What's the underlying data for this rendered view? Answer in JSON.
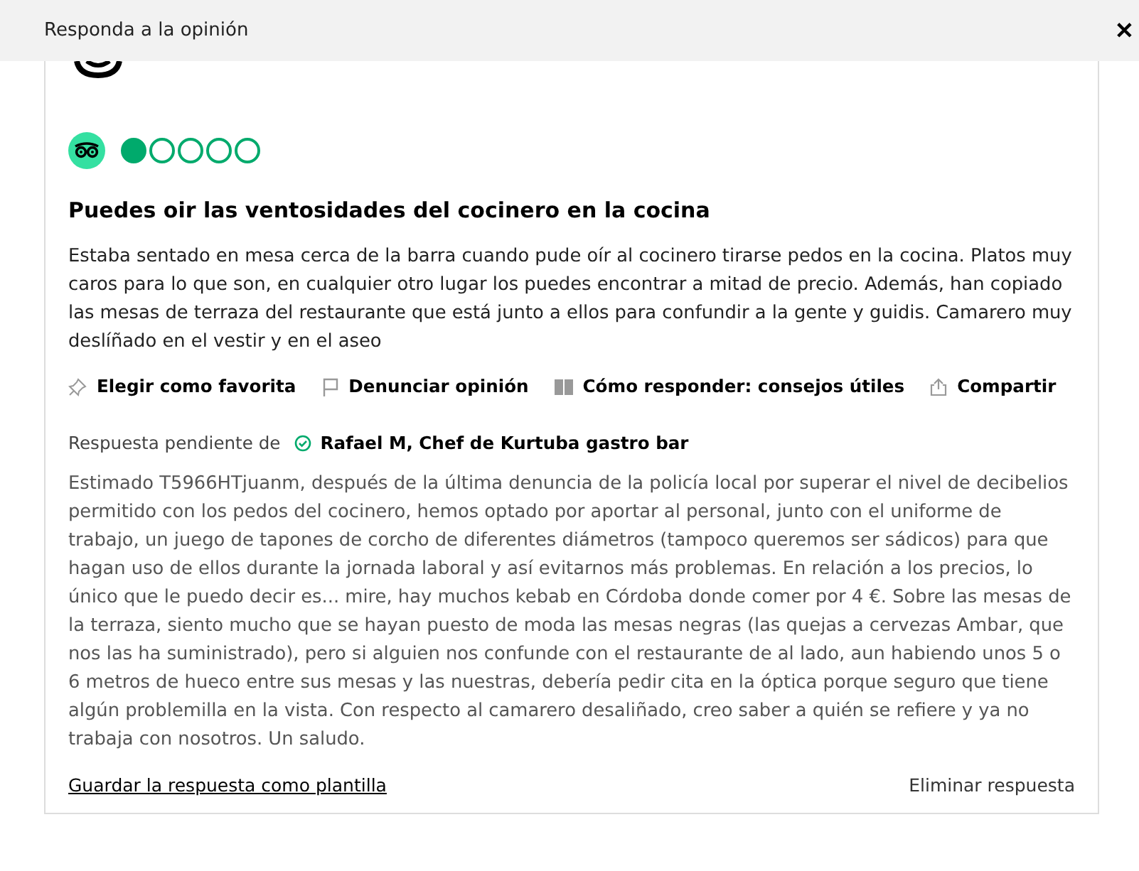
{
  "dialog": {
    "title": "Responda a la opinión",
    "close": "✕"
  },
  "review": {
    "stars": 1,
    "title": "Puedes oir las ventosidades del cocinero en la cocina",
    "text": "Estaba sentado en mesa cerca de la barra cuando pude oír al cocinero tirarse pedos en la cocina. Platos muy caros para lo que son, en cualquier otro lugar los puedes encontrar a mitad de precio. Además, han copiado las mesas de terraza del restaurante que está junto a ellos para confundir a la gente y guidis. Camarero muy deslíñado en el vestir y en el aseo"
  },
  "actions": [
    {
      "kind": "pin",
      "label": "Elegir como favorita"
    },
    {
      "kind": "flag",
      "label": "Denunciar opinión"
    },
    {
      "kind": "book",
      "label": "Cómo responder: consejos útiles"
    },
    {
      "kind": "share",
      "label": "Compartir"
    }
  ],
  "response": {
    "label": "Respuesta pendiente de",
    "author": "Rafael M, Chef de Kurtuba gastro bar",
    "verified": true,
    "text": "Estimado T5966HTjuanm, después de la última denuncia de la policía local por superar el nivel de decibelios permitido con los pedos del cocinero, hemos optado por aportar al personal, junto con el uniforme de trabajo, un juego de tapones de corcho de diferentes diámetros (tampoco queremos ser sádicos) para que hagan uso de ellos durante la jornada laboral y así evitarnos más problemas. En relación a los precios, lo único que le puedo decir es... mire, hay muchos kebab en Córdoba donde comer por 4 €. Sobre las mesas de la terraza, siento mucho que se hayan puesto de moda las mesas negras (las quejas a cervezas Ambar, que nos las ha suministrado), pero si alguien nos confunde con el restaurante de al lado, aun habiendo unos 5 o 6 metros de hueco entre sus mesas y las nuestras, debería pedir cita en la óptica porque seguro que tiene algún problemilla en la vista. Con respecto al camarero desaliñado, creo saber a quién se refiere y ya no trabaja con nosotros. Un saludo.",
    "save": "Guardar la respuesta como plantilla",
    "delete": "Eliminar respuesta"
  }
}
